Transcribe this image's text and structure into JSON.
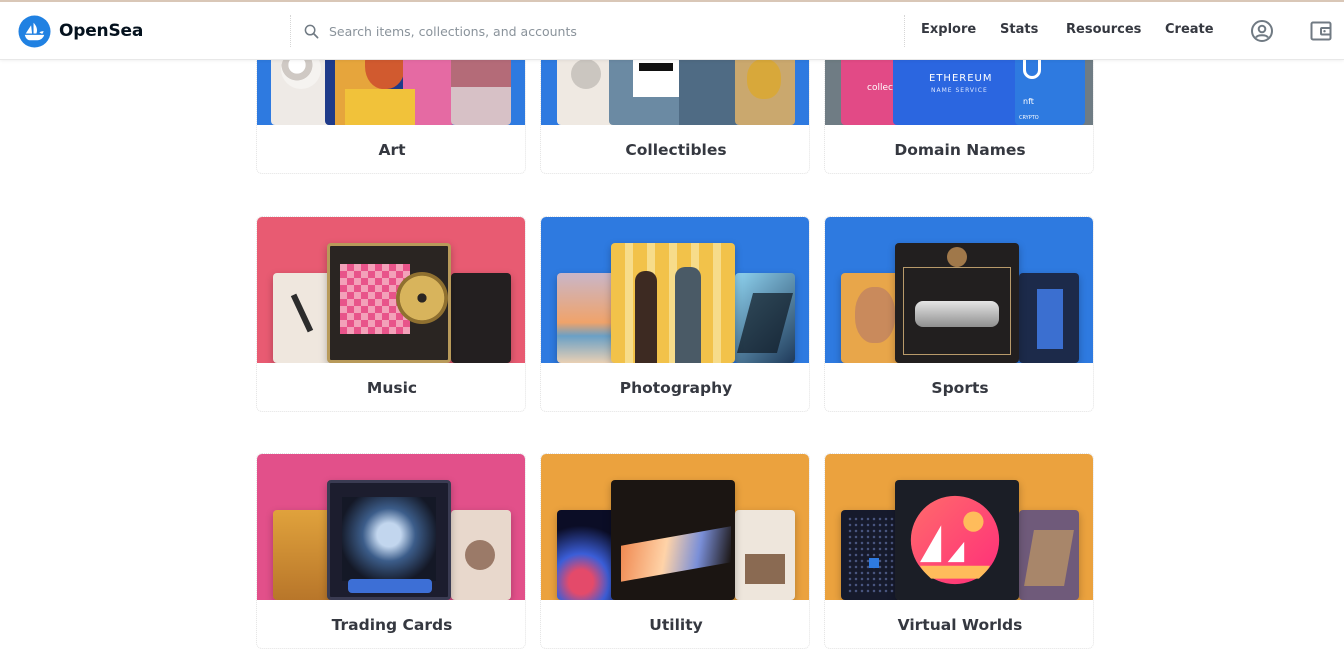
{
  "brand": {
    "name": "OpenSea",
    "logo_icon": "opensea-boat-logo",
    "accent": "#2081e2"
  },
  "search": {
    "placeholder": "Search items, collections, and accounts",
    "value": ""
  },
  "nav": {
    "items": [
      {
        "label": "Explore"
      },
      {
        "label": "Stats"
      },
      {
        "label": "Resources"
      },
      {
        "label": "Create"
      }
    ],
    "account_icon": "account-circle-icon",
    "wallet_icon": "wallet-icon"
  },
  "categories": [
    {
      "label": "Art",
      "bg": "#2e7ae0"
    },
    {
      "label": "Collectibles",
      "bg": "#2e7ae0"
    },
    {
      "label": "Domain Names",
      "bg": "#2e7ae0"
    },
    {
      "label": "Music",
      "bg": "#e85b72"
    },
    {
      "label": "Photography",
      "bg": "#2e7ae0"
    },
    {
      "label": "Sports",
      "bg": "#2e7ae0"
    },
    {
      "label": "Trading Cards",
      "bg": "#e2508a"
    },
    {
      "label": "Utility",
      "bg": "#eba23e"
    },
    {
      "label": "Virtual Worlds",
      "bg": "#eba23e"
    }
  ],
  "domain_art_text": {
    "left": "collect",
    "ens_title": "ETHEREUM",
    "ens_sub": "NAME SERVICE",
    "nft": "nft",
    "crypto": "CRYPTO"
  }
}
